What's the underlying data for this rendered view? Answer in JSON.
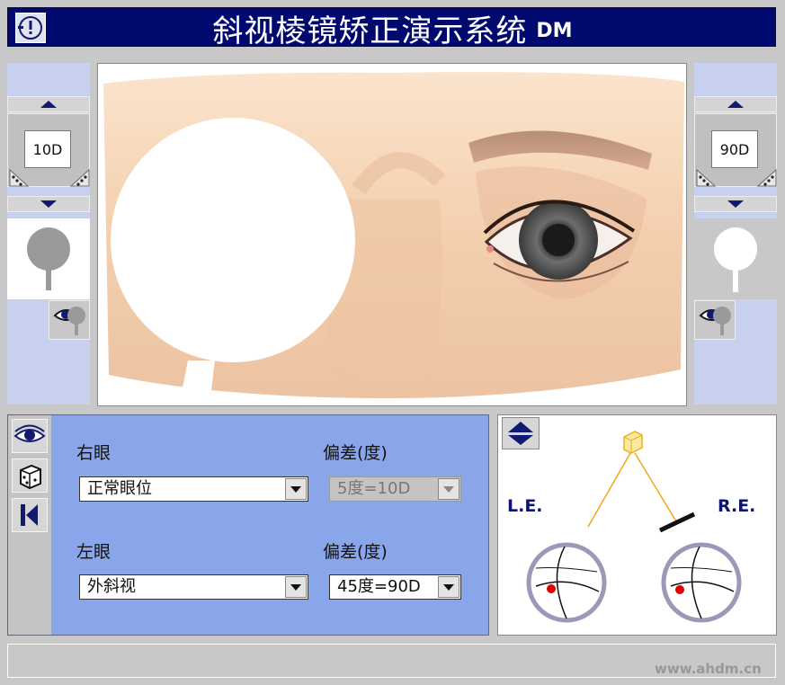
{
  "title": "斜视棱镜矫正演示系统",
  "title_badge": "DM",
  "left_panel": {
    "prism_value": "10D"
  },
  "right_panel": {
    "prism_value": "90D"
  },
  "controls": {
    "right_eye_label": "右眼",
    "right_eye_deviation_label": "偏差(度)",
    "right_eye_position": "正常眼位",
    "right_eye_deviation": "5度=10D",
    "left_eye_label": "左眼",
    "left_eye_deviation_label": "偏差(度)",
    "left_eye_position": "外斜视",
    "left_eye_deviation": "45度=90D"
  },
  "diagram": {
    "left_label": "L.E.",
    "right_label": "R.E."
  },
  "watermark": "www.ahdm.cn",
  "colors": {
    "title_bg": "#000a6e",
    "panel_bg": "#8aa6ea",
    "label_color": "#0d1570",
    "pupil_mark": "#e00000"
  }
}
